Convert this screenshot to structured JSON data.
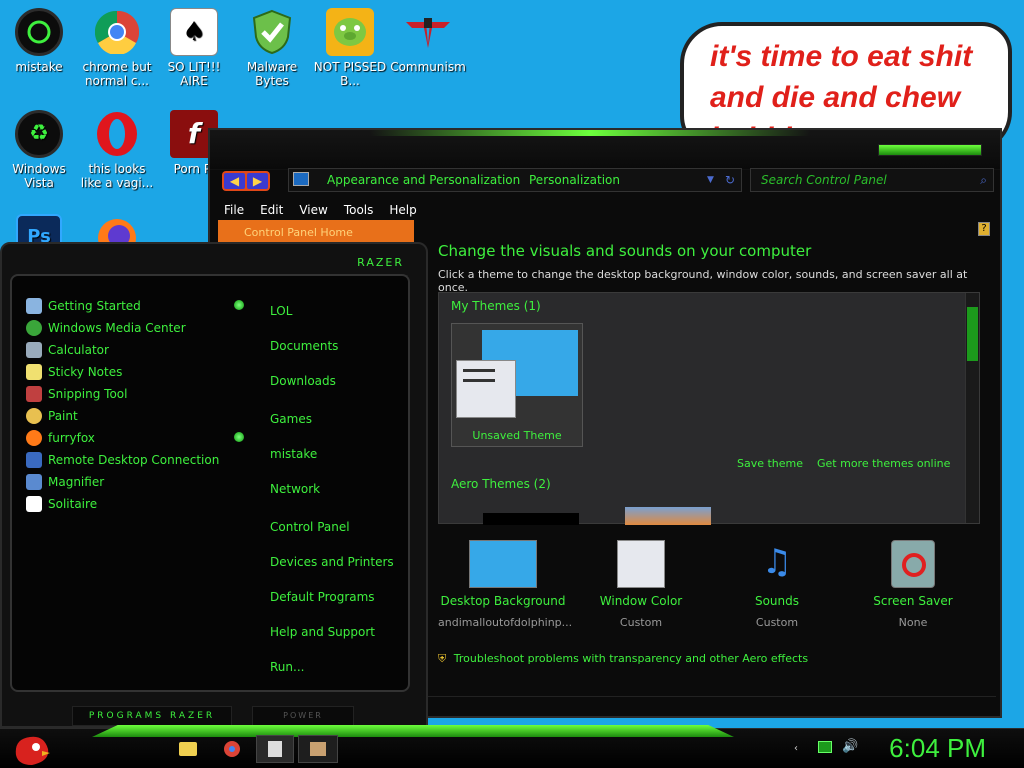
{
  "desktop": {
    "icons": [
      {
        "label": "mistake",
        "icon": "razer-logo-icon"
      },
      {
        "label": "chrome but normal c...",
        "icon": "chrome-icon"
      },
      {
        "label": "SO LIT!!! AIRE",
        "icon": "solitaire-cards-icon"
      },
      {
        "label": "Malware Bytes",
        "icon": "shield-check-icon"
      },
      {
        "label": "NOT PISSED B...",
        "icon": "angry-birds-pig-icon"
      },
      {
        "label": "Communism",
        "icon": "communism-emblem-icon"
      },
      {
        "label": "Windows Vista",
        "icon": "recycle-icon"
      },
      {
        "label": "this looks like a vagi...",
        "icon": "opera-icon"
      },
      {
        "label": "Porn Pl",
        "icon": "flash-icon"
      },
      {
        "label": "",
        "icon": "photoshop-icon"
      },
      {
        "label": "",
        "icon": "firefox-icon"
      }
    ],
    "speech_bubble": "it's time to eat shit and die and chew bubble gum"
  },
  "control_panel": {
    "breadcrumb": [
      "Appearance and Personalization",
      "Personalization"
    ],
    "search_placeholder": "Search Control Panel",
    "menu": [
      "File",
      "Edit",
      "View",
      "Tools",
      "Help"
    ],
    "left_link": "Control Panel Home",
    "title": "Change the visuals and sounds on your computer",
    "subtitle": "Click a theme to change the desktop background, window color, sounds, and screen saver all at once.",
    "my_themes": "My Themes (1)",
    "theme_card_label": "Unsaved Theme",
    "save_theme": "Save theme",
    "get_more": "Get more themes online",
    "aero_themes": "Aero Themes (2)",
    "items": [
      {
        "title": "Desktop Background",
        "sub": "andimalloutofdolphinp..."
      },
      {
        "title": "Window Color",
        "sub": "Custom"
      },
      {
        "title": "Sounds",
        "sub": "Custom"
      },
      {
        "title": "Screen Saver",
        "sub": "None"
      }
    ],
    "troubleshoot": "Troubleshoot problems with transparency and other Aero effects"
  },
  "start_menu": {
    "brand": "RAZER",
    "programs": [
      "Getting Started",
      "Windows Media Center",
      "Calculator",
      "Sticky Notes",
      "Snipping Tool",
      "Paint",
      "furryfox",
      "Remote Desktop Connection",
      "Magnifier",
      "Solitaire"
    ],
    "right_links": [
      "LOL",
      "Documents",
      "Downloads",
      "Games",
      "mistake",
      "Network",
      "Control Panel",
      "Devices and Printers",
      "Default Programs",
      "Help and Support",
      "Run..."
    ],
    "programs_footer": "PROGRAMS RAZER",
    "power_footer": "POWER"
  },
  "taskbar": {
    "clock": "6:04 PM"
  },
  "colors": {
    "accent_green": "#3ef03e",
    "desktop_blue": "#1ca6e6",
    "bubble_text": "#e0201a"
  }
}
